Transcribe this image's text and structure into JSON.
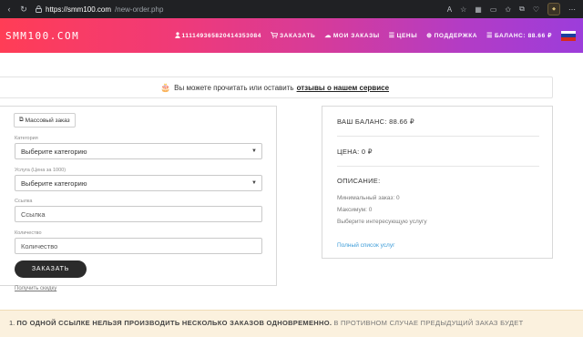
{
  "browser": {
    "url_host": "https://smm100.com",
    "url_path": "/new-order.php"
  },
  "header": {
    "logo": "SMM100.COM",
    "nav": [
      {
        "icon": "user-icon",
        "label": "111149365820414353084"
      },
      {
        "icon": "cart-icon",
        "label": "ЗАКАЗАТЬ"
      },
      {
        "icon": "orders-icon",
        "label": "МОИ ЗАКАЗЫ"
      },
      {
        "icon": "prices-icon",
        "label": "ЦЕНЫ"
      },
      {
        "icon": "support-icon",
        "label": "ПОДДЕРЖКА"
      },
      {
        "icon": "balance-icon",
        "label": "БАЛАНС: 88.66 ₽"
      }
    ],
    "flag_colors": [
      "#ffffff",
      "#1c3f9e",
      "#d52b1e"
    ]
  },
  "notice": {
    "text": "Вы можете прочитать или оставить",
    "link": "отзывы о нашем сервисе"
  },
  "form": {
    "mass_order_label": "Массовый заказ",
    "category_label": "Категория",
    "category_value": "Выберите категорию",
    "service_label": "Услуга (Цена за 1000)",
    "service_value": "Выберите категорию",
    "link_label": "Ссылка",
    "link_placeholder": "Ссылка",
    "quantity_label": "Количество",
    "quantity_placeholder": "Количество",
    "submit_label": "ЗАКАЗАТЬ",
    "discount_link": "Получить скидку"
  },
  "info": {
    "balance": "ВАШ БАЛАНС: 88.66 ₽",
    "price": "ЦЕНА: 0 ₽",
    "description_title": "ОПИСАНИЕ:",
    "min_order": "Минимальный заказ: 0",
    "max_order": "Максимум: 0",
    "hint": "Выберите интересующую услугу",
    "services_link": "Полный список услуг"
  },
  "warning": {
    "number": "1.",
    "bold": "ПО ОДНОЙ ССЫЛКЕ НЕЛЬЗЯ ПРОИЗВОДИТЬ НЕСКОЛЬКО ЗАКАЗОВ ОДНОВРЕМЕННО.",
    "rest": "В ПРОТИВНОМ СЛУЧАЕ ПРЕДЫДУЩИЙ ЗАКАЗ БУДЕТ"
  },
  "colors": {
    "header_gradient_start": "#ff3d56",
    "header_gradient_end": "#9c3ddb",
    "button_dark": "#2b2b2b",
    "link_blue": "#3c9cd8",
    "warning_bg": "#fbf1de"
  }
}
